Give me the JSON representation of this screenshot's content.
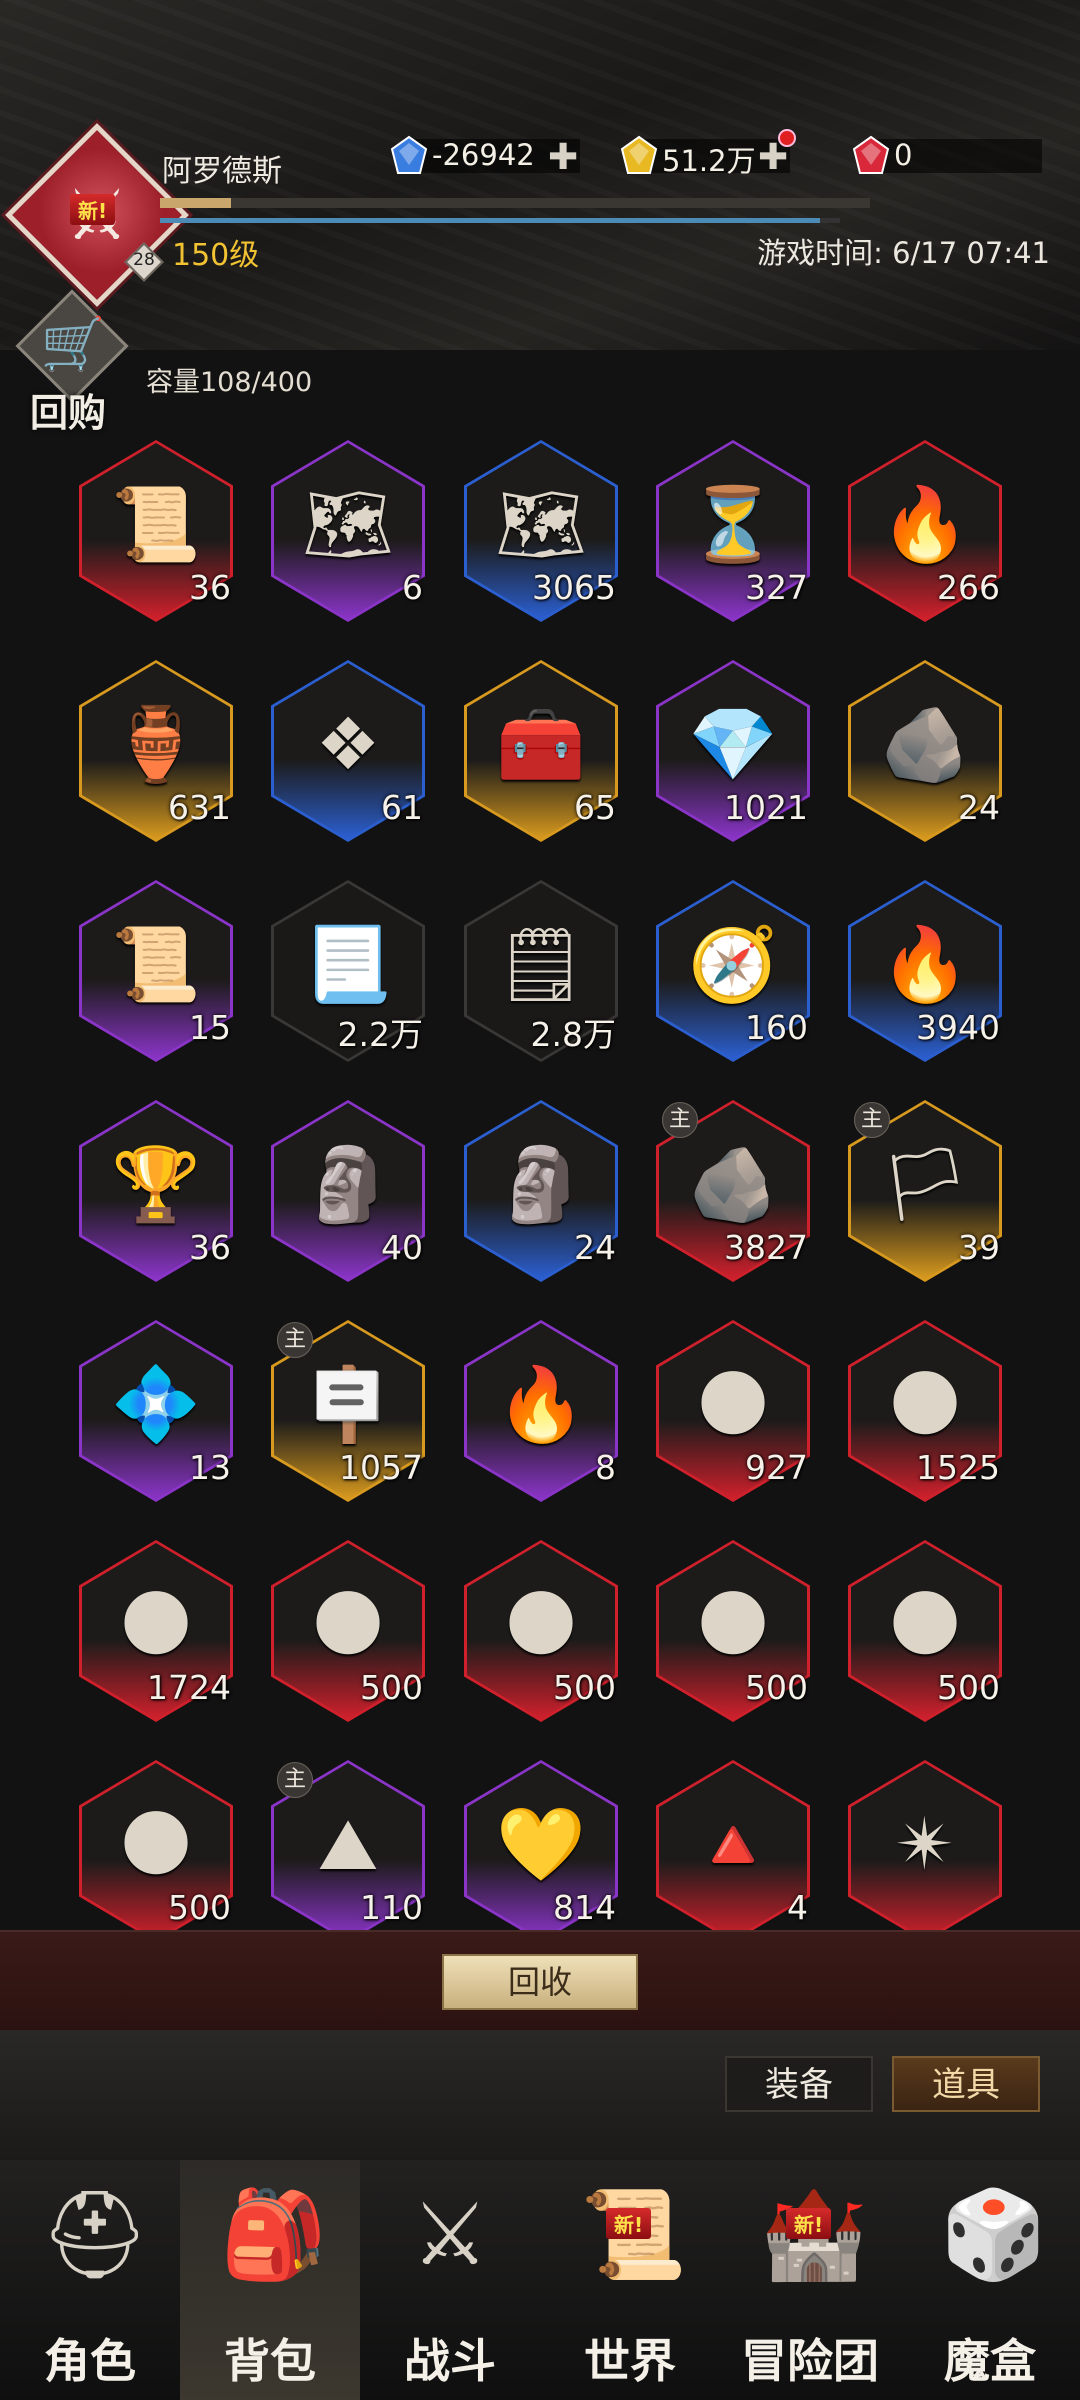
{
  "player": {
    "name": "阿罗德斯",
    "level_label": "150级",
    "rank_badge": "28",
    "avatar_badge": "新!",
    "xp_progress": 0.1,
    "stamina_progress": 0.97
  },
  "currencies": [
    {
      "name": "blue-gem",
      "value": "-26942",
      "color": "#3a7de0",
      "has_plus": true,
      "has_dot": false
    },
    {
      "name": "gold-gem",
      "value": "51.2万",
      "color": "#e8b923",
      "has_plus": true,
      "has_dot": true
    },
    {
      "name": "red-gem",
      "value": "0",
      "color": "#d8283a",
      "has_plus": false,
      "has_dot": false
    }
  ],
  "game_time": "游戏时间: 6/17 07:41",
  "buyback_label": "回购",
  "capacity": "容量108/400",
  "items": [
    {
      "icon": "scroll-map-icon",
      "glyph": "📜",
      "count": "36",
      "rarity": "red"
    },
    {
      "icon": "treasure-map-icon",
      "glyph": "🗺",
      "count": "6",
      "rarity": "purple"
    },
    {
      "icon": "chest-map-icon",
      "glyph": "🗺",
      "count": "3065",
      "rarity": "blue"
    },
    {
      "icon": "hourglass-icon",
      "glyph": "⏳",
      "count": "327",
      "rarity": "purple"
    },
    {
      "icon": "flame-icon",
      "glyph": "🔥",
      "count": "266",
      "rarity": "red"
    },
    {
      "icon": "sand-jar-icon",
      "glyph": "🏺",
      "count": "631",
      "rarity": "gold"
    },
    {
      "icon": "laurel-crystal-icon",
      "glyph": "❖",
      "count": "61",
      "rarity": "blue"
    },
    {
      "icon": "ornate-chest-icon",
      "glyph": "🧰",
      "count": "65",
      "rarity": "gold"
    },
    {
      "icon": "crystal-cluster-icon",
      "glyph": "💎",
      "count": "1021",
      "rarity": "purple"
    },
    {
      "icon": "rune-stone-icon",
      "glyph": "🪨",
      "count": "24",
      "rarity": "gold"
    },
    {
      "icon": "sealed-scroll-icon",
      "glyph": "📜",
      "count": "15",
      "rarity": "purple"
    },
    {
      "icon": "torn-scroll-icon",
      "glyph": "📃",
      "count": "2.2万",
      "rarity": "none"
    },
    {
      "icon": "paper-scrap-icon",
      "glyph": "🗒",
      "count": "2.8万",
      "rarity": "none"
    },
    {
      "icon": "compass-icon",
      "glyph": "🧭",
      "count": "160",
      "rarity": "blue"
    },
    {
      "icon": "torch-icon",
      "glyph": "🔥",
      "count": "3940",
      "rarity": "blue"
    },
    {
      "icon": "chalice-icon",
      "glyph": "🏆",
      "count": "36",
      "rarity": "purple"
    },
    {
      "icon": "rune-tablet-icon",
      "glyph": "🗿",
      "count": "40",
      "rarity": "purple"
    },
    {
      "icon": "rune-tablet-icon",
      "glyph": "🗿",
      "count": "24",
      "rarity": "blue"
    },
    {
      "icon": "carved-stone-icon",
      "glyph": "🪨",
      "count": "3827",
      "rarity": "red",
      "main": "主"
    },
    {
      "icon": "claw-banner-icon",
      "glyph": "🏳",
      "count": "39",
      "rarity": "gold",
      "main": "主"
    },
    {
      "icon": "gemstone-icon",
      "glyph": "💠",
      "count": "13",
      "rarity": "purple"
    },
    {
      "icon": "claw-slab-icon",
      "glyph": "🪧",
      "count": "1057",
      "rarity": "gold",
      "main": "主"
    },
    {
      "icon": "spirit-flame-icon",
      "glyph": "🔥",
      "count": "8",
      "rarity": "purple"
    },
    {
      "icon": "moon-rock-icon",
      "glyph": "🌑",
      "count": "927",
      "rarity": "red"
    },
    {
      "icon": "moon-rock-icon",
      "glyph": "🌑",
      "count": "1525",
      "rarity": "red"
    },
    {
      "icon": "moon-rock-icon",
      "glyph": "🌑",
      "count": "1724",
      "rarity": "red"
    },
    {
      "icon": "moon-rock-icon",
      "glyph": "🌑",
      "count": "500",
      "rarity": "red"
    },
    {
      "icon": "moon-rock-icon",
      "glyph": "🌑",
      "count": "500",
      "rarity": "red"
    },
    {
      "icon": "moon-rock-icon",
      "glyph": "🌑",
      "count": "500",
      "rarity": "red"
    },
    {
      "icon": "moon-rock-icon",
      "glyph": "🌑",
      "count": "500",
      "rarity": "red"
    },
    {
      "icon": "moon-rock-icon",
      "glyph": "🌑",
      "count": "500",
      "rarity": "red"
    },
    {
      "icon": "sand-pile-icon",
      "glyph": "⛰",
      "count": "110",
      "rarity": "purple",
      "main": "主"
    },
    {
      "icon": "golden-crystal-icon",
      "glyph": "💛",
      "count": "814",
      "rarity": "purple"
    },
    {
      "icon": "eye-pyramid-icon",
      "glyph": "🔺",
      "count": "4",
      "rarity": "red"
    },
    {
      "icon": "shard-star-icon",
      "glyph": "✴",
      "count": "",
      "rarity": "red"
    }
  ],
  "recycle_label": "回收",
  "tabs": {
    "equip": "装备",
    "items": "道具"
  },
  "nav": [
    {
      "label": "角色",
      "icon": "helmet-icon",
      "glyph": "⛑",
      "active": false,
      "new": ""
    },
    {
      "label": "背包",
      "icon": "backpack-icon",
      "glyph": "🎒",
      "active": true,
      "new": ""
    },
    {
      "label": "战斗",
      "icon": "sword-shield-icon",
      "glyph": "⚔",
      "active": false,
      "new": ""
    },
    {
      "label": "世界",
      "icon": "world-scroll-icon",
      "glyph": "📜",
      "active": false,
      "new": "新!"
    },
    {
      "label": "冒险团",
      "icon": "castle-icon",
      "glyph": "🏰",
      "active": false,
      "new": "新!"
    },
    {
      "label": "魔盒",
      "icon": "magic-cube-icon",
      "glyph": "🎲",
      "active": false,
      "new": ""
    }
  ],
  "rarity_colors": {
    "red": "#d0202c",
    "purple": "#8a34c8",
    "blue": "#2b5fd0",
    "gold": "#d89a1e",
    "none": "#3a3836"
  }
}
